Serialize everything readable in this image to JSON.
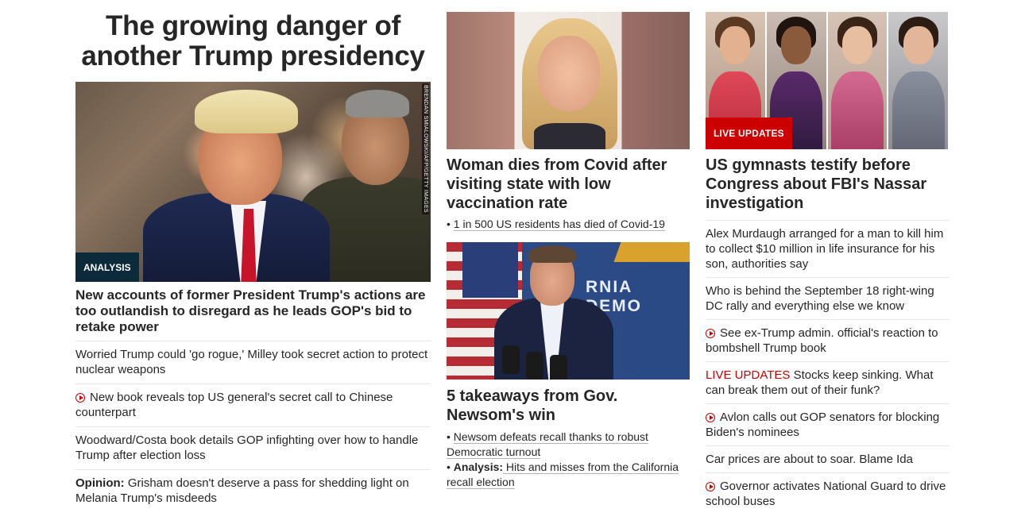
{
  "col1": {
    "hero_title": "The growing danger of another Trump presidency",
    "image_credit": "BRENDAN SMIALOWSKI/AFP/GETTY IMAGES",
    "tag": "ANALYSIS",
    "lead_headline": "New accounts of former President Trump's actions are too outlandish to disregard as he leads GOP's bid to retake power",
    "items": [
      {
        "text": "Worried Trump could 'go rogue,' Milley took secret action to protect nuclear weapons"
      },
      {
        "icon": "play-icon",
        "text": "New book reveals top US general's secret call to Chinese counterpart"
      },
      {
        "text": "Woodward/Costa book details GOP infighting over how to handle Trump after election loss"
      },
      {
        "prefix": "Opinion:",
        "text": " Grisham doesn't deserve a pass for shedding light on Melania Trump's misdeeds"
      }
    ]
  },
  "col2": {
    "story1": {
      "headline": "Woman dies from Covid after visiting state with low vaccination rate",
      "bullet": "1 in 500 US residents has died of Covid-19"
    },
    "story2": {
      "banner_text": "RNIA DEMO",
      "headline": "5 takeaways from Gov. Newsom's win",
      "bullet1": "Newsom defeats recall thanks to robust Democratic turnout",
      "bullet2_prefix": "Analysis:",
      "bullet2_text": " Hits and misses from the California recall election"
    }
  },
  "col3": {
    "tag": "LIVE UPDATES",
    "headline": "US gymnasts testify before Congress about FBI's Nassar investigation",
    "items": [
      {
        "text": "Alex Murdaugh arranged for a man to kill him to collect $10 million in life insurance for his son, authorities say"
      },
      {
        "text": "Who is behind the September 18 right-wing DC rally and everything else we know"
      },
      {
        "icon": "play-icon",
        "text": "See ex-Trump admin. official's reaction to bombshell Trump book"
      },
      {
        "live_prefix": "LIVE UPDATES",
        "text": " Stocks keep sinking. What can break them out of their funk?"
      },
      {
        "icon": "play-icon",
        "text": "Avlon calls out GOP senators for blocking Biden's nominees"
      },
      {
        "text": "Car prices are about to soar. Blame Ida"
      },
      {
        "icon": "play-icon",
        "text": "Governor activates National Guard to drive school buses"
      }
    ]
  },
  "colors": {
    "text": "#262626",
    "accent_red": "#cc0000",
    "analysis_tag_bg": "#0c2b3a",
    "divider": "#e6e6e6"
  }
}
